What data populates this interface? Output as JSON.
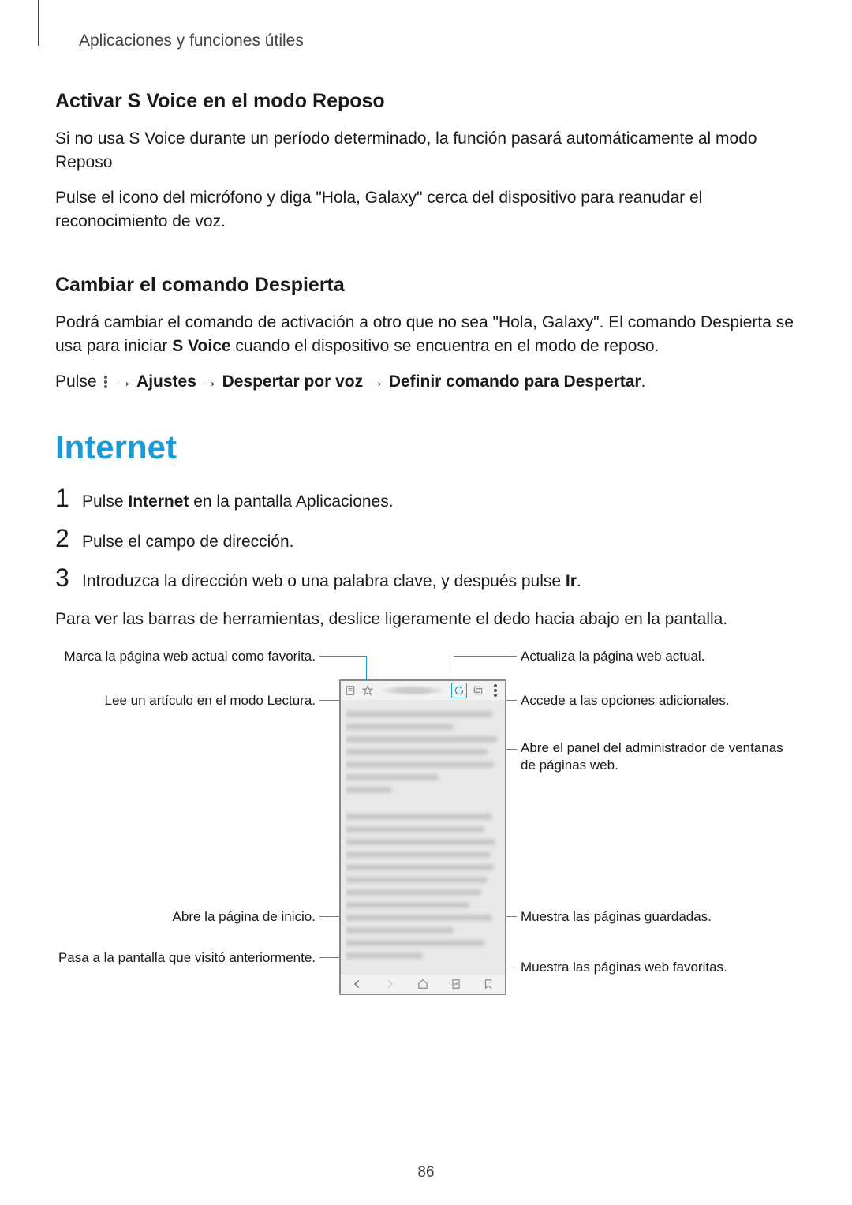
{
  "header": {
    "section": "Aplicaciones y funciones útiles"
  },
  "svoice_heading": "Activar S Voice en el modo Reposo",
  "svoice_p1": "Si no usa S Voice durante un período determinado, la función pasará automáticamente al modo Reposo",
  "svoice_p2": "Pulse el icono del micrófono y diga \"Hola, Galaxy\" cerca del dispositivo para reanudar el reconocimiento de voz.",
  "wake_heading": "Cambiar el comando Despierta",
  "wake_p1_a": "Podrá cambiar el comando de activación a otro que no sea \"Hola, Galaxy\". El comando Despierta se usa para iniciar ",
  "wake_p1_bold": "S Voice",
  "wake_p1_b": " cuando el dispositivo se encuentra en el modo de reposo.",
  "wake_p2_a": "Pulse ",
  "wake_p2_b": " → ",
  "wake_p2_c": "Ajustes",
  "wake_p2_d": " → ",
  "wake_p2_e": "Despertar por voz",
  "wake_p2_f": " → ",
  "wake_p2_g": "Definir comando para Despertar",
  "wake_p2_h": ".",
  "internet_heading": "Internet",
  "step1_a": "Pulse ",
  "step1_bold": "Internet",
  "step1_b": " en la pantalla Aplicaciones.",
  "step2": "Pulse el campo de dirección.",
  "step3_a": "Introduzca la dirección web o una palabra clave, y después pulse ",
  "step3_bold": "Ir",
  "step3_b": ".",
  "internet_p": "Para ver las barras de herramientas, deslice ligeramente el dedo hacia abajo en la pantalla.",
  "labels": {
    "bookmark": "Marca la página web actual como favorita.",
    "reader": "Lee un artículo en el modo Lectura.",
    "homepage": "Abre la página de inicio.",
    "back": "Pasa a la pantalla que visitó anteriormente.",
    "refresh": "Actualiza la página web actual.",
    "options": "Accede a las opciones adicionales.",
    "windows": "Abre el panel del administrador de ventanas de páginas web.",
    "saved": "Muestra las páginas guardadas.",
    "favorites": "Muestra las páginas web favoritas."
  },
  "page_number": "86"
}
